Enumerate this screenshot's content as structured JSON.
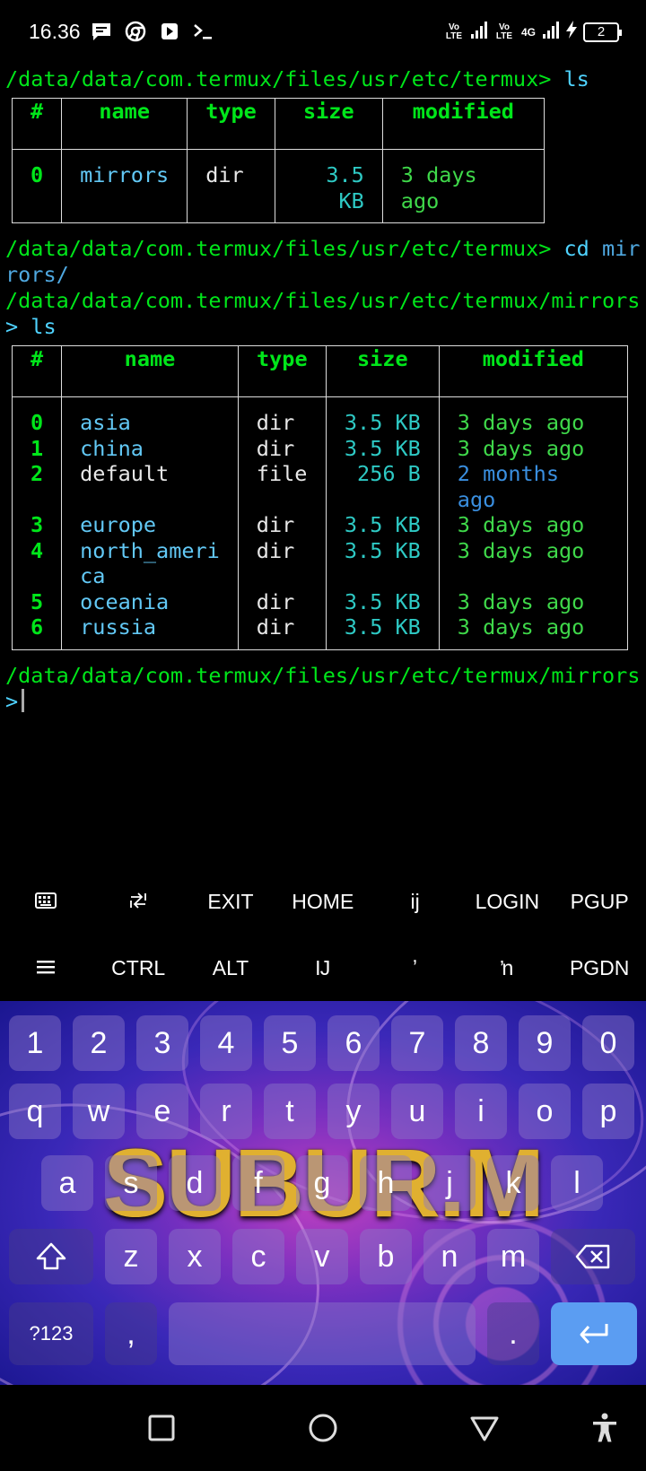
{
  "status_bar": {
    "time": "16.36",
    "left_icons": [
      "message-icon",
      "chrome-icon",
      "play-icon",
      "terminal-icon"
    ],
    "network1": "Vo LTE",
    "network2": "Vo LTE",
    "network3": "4G",
    "battery": "2"
  },
  "terminal": {
    "line1_path": "/data/data/com.termux/files/usr/etc/termux>",
    "line1_cmd": " ls",
    "table1": {
      "headers": [
        "#",
        "name",
        "type",
        "size",
        "modified"
      ],
      "rows": [
        {
          "idx": "0",
          "name": "mirrors",
          "type": "dir",
          "size": "3.5 KB",
          "modified": "3 days ago"
        }
      ]
    },
    "line2_path": "/data/data/com.termux/files/usr/etc/termux>",
    "line2_cmd": " cd",
    "line2_arg_a": " mir",
    "line2_arg_b": "rors/",
    "line3_path_a": "/data/data/com.termux/files/usr/etc/termux/mirrors",
    "line3_path_b": ">",
    "line3_cmd": " ls",
    "table2": {
      "headers": [
        "#",
        "name",
        "type",
        "size",
        "modified"
      ],
      "rows": [
        {
          "idx": "0",
          "name": "asia",
          "type": "dir",
          "size": "3.5 KB",
          "modified": "3 days ago"
        },
        {
          "idx": "1",
          "name": "china",
          "type": "dir",
          "size": "3.5 KB",
          "modified": "3 days ago"
        },
        {
          "idx": "2",
          "name": "default",
          "type": "file",
          "size": "256 B",
          "modified": "2 months ago"
        },
        {
          "idx": "3",
          "name": "europe",
          "type": "dir",
          "size": "3.5 KB",
          "modified": "3 days ago"
        },
        {
          "idx": "4",
          "name": "north_ameri",
          "name2": "ca",
          "type": "dir",
          "size": "3.5 KB",
          "modified": "3 days ago"
        },
        {
          "idx": "5",
          "name": "oceania",
          "type": "dir",
          "size": "3.5 KB",
          "modified": "3 days ago"
        },
        {
          "idx": "6",
          "name": "russia",
          "type": "dir",
          "size": "3.5 KB",
          "modified": "3 days ago"
        }
      ]
    },
    "line4_path_a": "/data/data/com.termux/files/usr/etc/termux/mirrors",
    "line4_path_b": ">"
  },
  "extra_keys": {
    "row1": [
      "keyboard-icon",
      "tab-icon",
      "EXIT",
      "HOME",
      "ij",
      "LOGIN",
      "PGUP"
    ],
    "row1_labels": {
      "exit": "EXIT",
      "home": "HOME",
      "ij": "ij",
      "login": "LOGIN",
      "pgup": "PGUP"
    },
    "row2_labels": {
      "ctrl": "CTRL",
      "alt": "ALT",
      "IJ": "Ĳ",
      "apos": "ʼ",
      "n": "ŉ",
      "pgdn": "PGDN"
    }
  },
  "keyboard": {
    "numbers": [
      "1",
      "2",
      "3",
      "4",
      "5",
      "6",
      "7",
      "8",
      "9",
      "0"
    ],
    "row_q": [
      "q",
      "w",
      "e",
      "r",
      "t",
      "y",
      "u",
      "i",
      "o",
      "p"
    ],
    "row_a": [
      "a",
      "s",
      "d",
      "f",
      "g",
      "h",
      "j",
      "k",
      "l"
    ],
    "row_z": [
      "z",
      "x",
      "c",
      "v",
      "b",
      "n",
      "m"
    ],
    "sym_key": "?123",
    "comma": ",",
    "period": ".",
    "theme_text": "SUBUR.M",
    "accent": "#5b9df2"
  },
  "navbar": {
    "icons": [
      "recent-apps-icon",
      "home-icon",
      "back-icon",
      "accessibility-icon"
    ]
  },
  "colors": {
    "terminal_green": "#00e61a",
    "command_cyan": "#4fd3ff",
    "dir_name": "#62c8f5",
    "size_teal": "#2ec9c4",
    "recent_green": "#3fd84a",
    "old_blue": "#3a8fe0"
  }
}
